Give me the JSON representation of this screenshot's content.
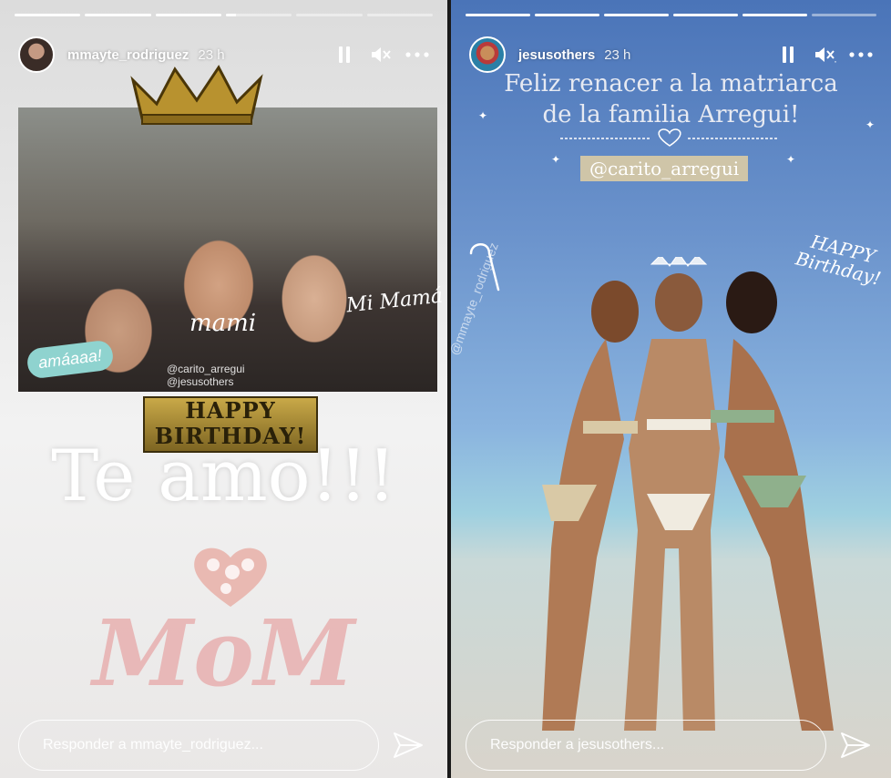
{
  "stories": [
    {
      "username": "mmayte_rodriguez",
      "time": "23 h",
      "progress_segments": [
        1,
        1,
        1,
        0.15,
        0,
        0
      ],
      "stickers": {
        "mami": "mami",
        "mi_mama": "Mi Mamá",
        "bubble": "amáaaa!",
        "tag_line1": "@carito_arregui",
        "tag_line2": "@jesusothers",
        "happy": "HAPPY",
        "birthday": "BIRTHDAY!",
        "te_amo": "Te amo!!!",
        "mom": "MoM"
      },
      "reply_placeholder": "Responder a mmayte_rodriguez..."
    },
    {
      "username": "jesusothers",
      "time": "23 h",
      "progress_segments": [
        1,
        1,
        1,
        1,
        1,
        0
      ],
      "caption_line1": "Feliz renacer a la matriarca",
      "caption_line2": "de la familia Arregui!",
      "tag": "@carito_arregui",
      "mention_vertical": "@mmayte_rodriguez",
      "happy": "HAPPY",
      "birthday": "Birthday!",
      "reply_placeholder": "Responder a jesusothers..."
    }
  ],
  "icons": [
    "pause-icon",
    "mute-icon",
    "more-options-icon",
    "send-icon"
  ]
}
